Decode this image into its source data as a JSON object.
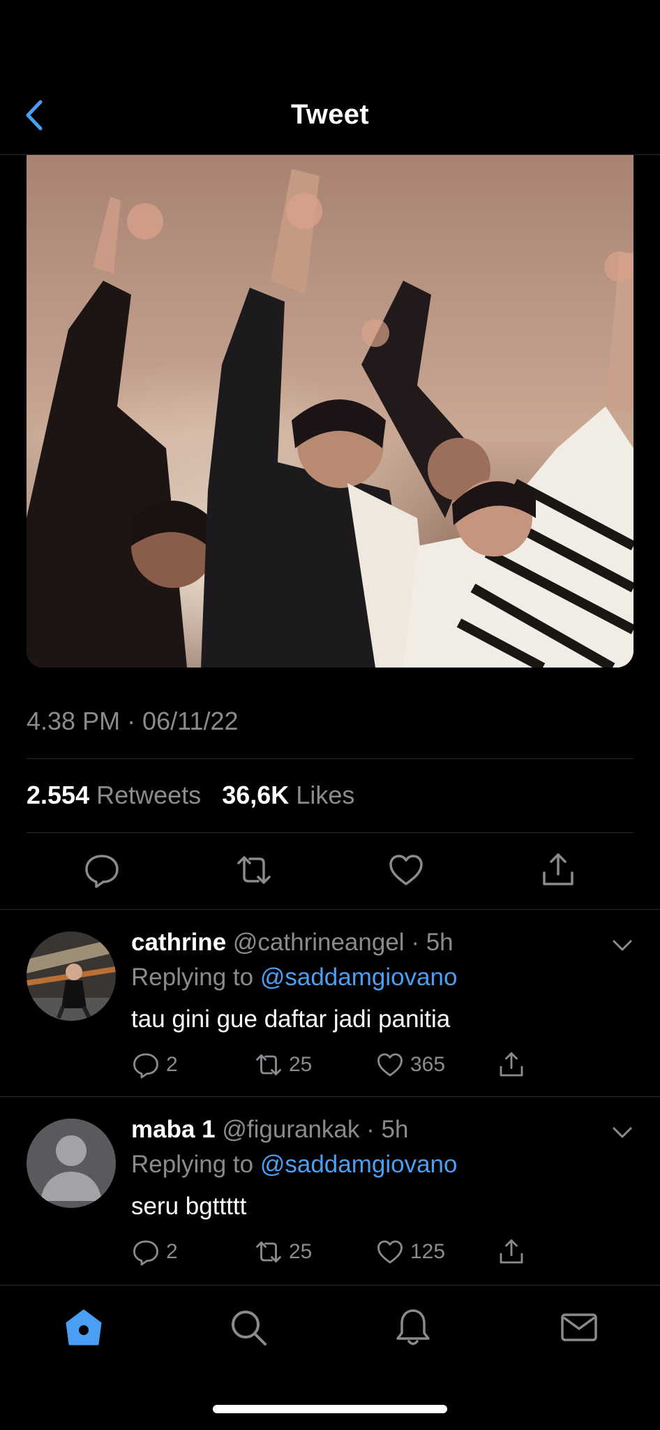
{
  "header": {
    "title": "Tweet",
    "back_icon": "chevron-left-icon"
  },
  "tweet": {
    "timestamp": "4.38 PM · 06/11/22",
    "retweets_count": "2.554",
    "retweets_label": "Retweets",
    "likes_count": "36,6K",
    "likes_label": "Likes",
    "actions": [
      "reply-icon",
      "retweet-icon",
      "like-icon",
      "share-icon"
    ]
  },
  "replies": [
    {
      "name": "cathrine",
      "handle": "@cathrineangel",
      "time": "· 5h",
      "replying_prefix": "Replying to ",
      "replying_to": "@saddamgiovano",
      "text": "tau gini gue daftar jadi panitia",
      "reply_count": "2",
      "retweet_count": "25",
      "like_count": "365"
    },
    {
      "name": "maba 1",
      "handle": "@figurankak",
      "time": "· 5h",
      "replying_prefix": "Replying to ",
      "replying_to": "@saddamgiovano",
      "text": "seru bgttttt",
      "reply_count": "2",
      "retweet_count": "25",
      "like_count": "125"
    }
  ],
  "tabbar": {
    "tabs": [
      "home-icon",
      "search-icon",
      "bell-icon",
      "mail-icon"
    ],
    "active_color": "#4a9ff5"
  },
  "colors": {
    "accent": "#4a9ff5",
    "muted": "#8b8b8f",
    "background": "#000000"
  }
}
